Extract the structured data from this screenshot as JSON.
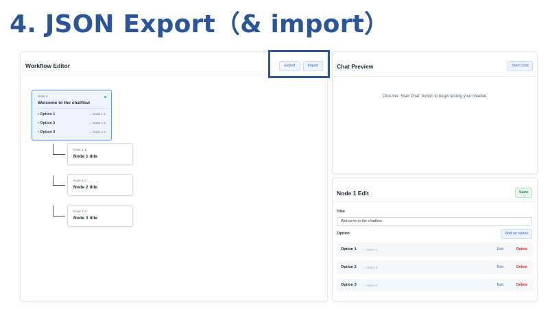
{
  "slide": {
    "title": "4. JSON Export（& import）"
  },
  "workflow": {
    "title": "Workflow Editor",
    "export_label": "Export",
    "import_label": "Import",
    "root": {
      "id": "Node 1",
      "title": "Welcome to the chatflow",
      "status_color": "#34c76b",
      "options": [
        {
          "label": "Option 1",
          "target": "→ Node 1-1"
        },
        {
          "label": "Option 2",
          "target": "→ Node 1-2"
        },
        {
          "label": "Option 3",
          "target": "→ Node 1-3"
        }
      ]
    },
    "children": [
      {
        "id": "Node 1-1",
        "title": "Node 1 title"
      },
      {
        "id": "Node 1-2",
        "title": "Node 2 title"
      },
      {
        "id": "Node 1-3",
        "title": "Node 3 title"
      }
    ]
  },
  "chat_preview": {
    "title": "Chat Preview",
    "start_label": "Start Chat",
    "placeholder": "Click the `Start Chat` button to begin testing your chatbot."
  },
  "node_edit": {
    "title": "Node 1 Edit",
    "save_label": "Save",
    "title_label": "Title",
    "title_value": "Welcome to the chatflow",
    "option_label": "Option",
    "add_option_label": "Add an option",
    "options": [
      {
        "name": "Option 1",
        "link": "→ Node1-1",
        "edit": "Edit",
        "delete": "Delete"
      },
      {
        "name": "Option 2",
        "link": "→ Node1-2",
        "edit": "Edit",
        "delete": "Delete"
      },
      {
        "name": "Option 3",
        "link": "→ Node1-3",
        "edit": "Edit",
        "delete": "Delete"
      }
    ]
  },
  "colors": {
    "title_blue": "#2b5597",
    "accent_blue": "#2a64c5",
    "danger_red": "#dc2626",
    "save_green": "#1f8a47"
  }
}
